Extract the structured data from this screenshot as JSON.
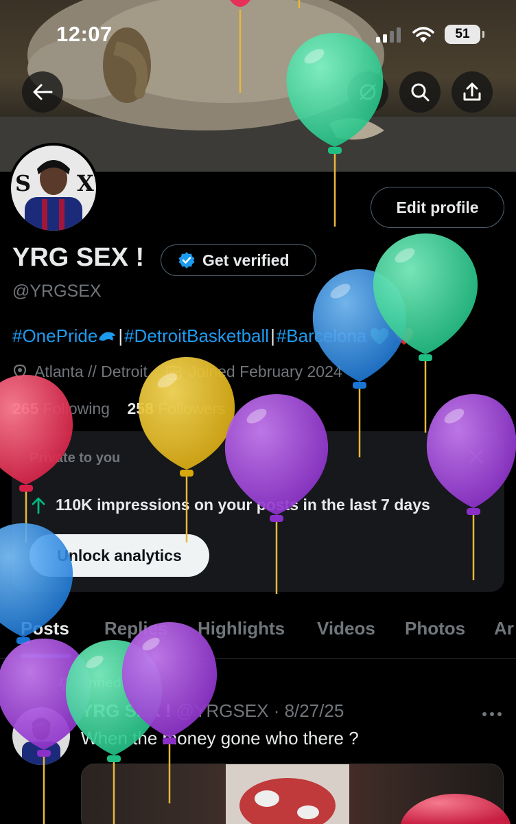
{
  "status_bar": {
    "time": "12:07",
    "battery": "51"
  },
  "profile": {
    "name": "YRG SEX !",
    "verify_label": "Get verified",
    "handle": "@YRGSEX",
    "edit_label": "Edit profile",
    "bio": {
      "tag1": "#OnePride",
      "tag2": "#DetroitBasketball",
      "tag3": "#Barcelona",
      "separator": " |"
    },
    "location": "Atlanta // Detroit",
    "joined": "Joined February 2024",
    "following_count": "265",
    "following_label": "Following",
    "followers_count": "258",
    "followers_label": "Followers"
  },
  "analytics_card": {
    "title": "Private to you",
    "message": "110K impressions on your posts in the last 7 days",
    "button": "Unlock analytics"
  },
  "tabs": [
    "Posts",
    "Replies",
    "Highlights",
    "Videos",
    "Photos",
    "Ar"
  ],
  "post": {
    "pinned_label": "Pinned",
    "author": "YRG SEX !",
    "handle_date": "@YRGSEX · 8/27/25",
    "text": "When the money gone who there ?"
  },
  "colors": {
    "accent": "#1d9bf0",
    "background": "#000000",
    "muted": "#71767b"
  }
}
